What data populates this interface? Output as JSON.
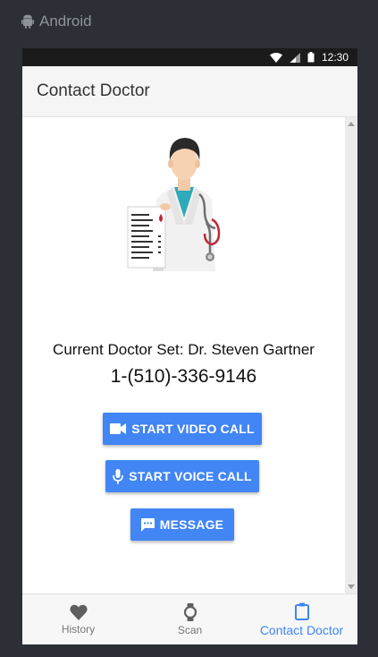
{
  "emulator": {
    "label": "Android",
    "icon": "android-icon"
  },
  "status_bar": {
    "time": "12:30",
    "icons": [
      "wifi-icon",
      "signal-icon",
      "battery-icon"
    ]
  },
  "app_bar": {
    "title": "Contact Doctor"
  },
  "doctor": {
    "current_label": "Current Doctor Set: Dr. Steven Gartner",
    "phone": "1-(510)-336-9146"
  },
  "actions": {
    "video_call": {
      "label": "START VIDEO CALL",
      "icon": "videocam-icon"
    },
    "voice_call": {
      "label": "START VOICE CALL",
      "icon": "mic-icon"
    },
    "message": {
      "label": "MESSAGE",
      "icon": "chat-icon"
    }
  },
  "bottom_nav": {
    "items": [
      {
        "label": "History",
        "icon": "heart-icon",
        "active": false
      },
      {
        "label": "Scan",
        "icon": "watch-icon",
        "active": false
      },
      {
        "label": "Contact Doctor",
        "icon": "clipboard-icon",
        "active": true
      }
    ]
  },
  "colors": {
    "accent": "#4285f4",
    "active_nav": "#3f86f5",
    "background": "#2c2f35"
  }
}
